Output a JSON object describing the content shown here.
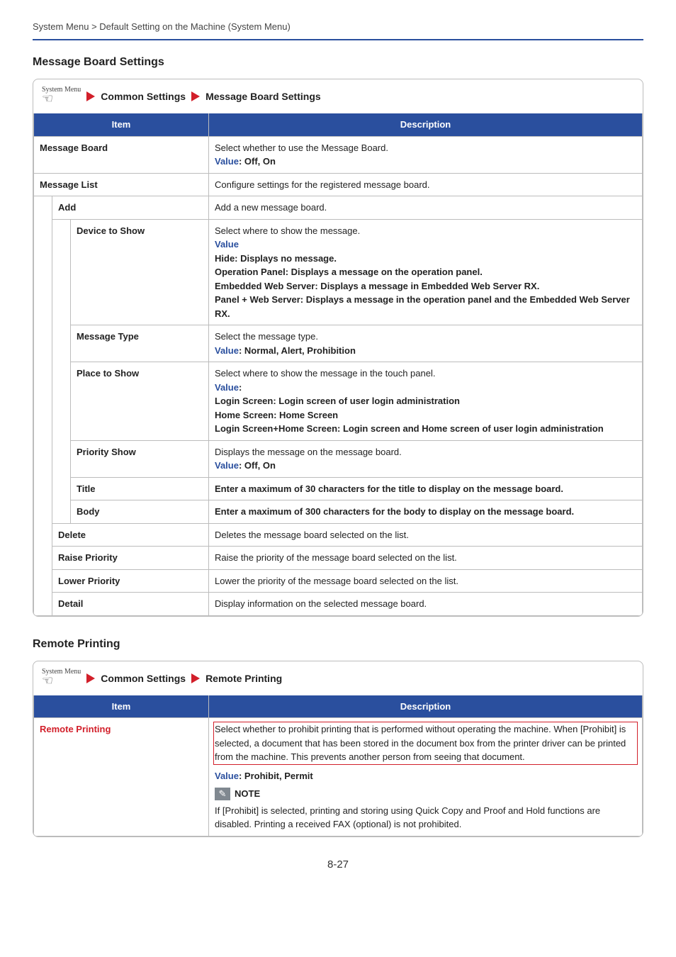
{
  "header": "System Menu > Default Setting on the Machine (System Menu)",
  "pageNumber": "8-27",
  "section1": {
    "title": "Message Board Settings",
    "breadcrumb": {
      "sys": "System Menu",
      "a": "Common Settings",
      "b": "Message Board Settings"
    },
    "th_item": "Item",
    "th_desc": "Description",
    "rows": {
      "msgboard": {
        "item": "Message Board",
        "d1": "Select whether to use the Message Board.",
        "d2a": "Value",
        "d2b": ": Off, On"
      },
      "msglist": {
        "item": "Message List",
        "d": "Configure settings for the registered message board."
      },
      "add": {
        "item": "Add",
        "d": "Add a new message board."
      },
      "device": {
        "item": "Device to Show",
        "d1": "Select where to show the message.",
        "d2": "Value",
        "d3": "Hide: Displays no message.",
        "d4": "Operation Panel: Displays a message on the operation panel.",
        "d5": "Embedded Web Server: Displays a message in Embedded Web Server RX.",
        "d6": "Panel + Web Server: Displays a message in the operation panel and the Embedded Web Server RX."
      },
      "mtype": {
        "item": "Message Type",
        "d1": "Select the message type.",
        "d2a": "Value",
        "d2b": ": Normal, Alert, Prohibition"
      },
      "place": {
        "item": "Place to Show",
        "d1": "Select where to show the message in the touch panel.",
        "d2a": "Value",
        "d2b": ":",
        "d3": "Login Screen: Login screen of user login administration",
        "d4": "Home Screen: Home Screen",
        "d5": "Login Screen+Home Screen: Login screen and Home screen of user login administration"
      },
      "prio": {
        "item": "Priority Show",
        "d1": "Displays the message on the message board.",
        "d2a": "Value",
        "d2b": ": Off, On"
      },
      "ttl": {
        "item": "Title",
        "d": "Enter a maximum of 30 characters for the title to display on the message board."
      },
      "body": {
        "item": "Body",
        "d": "Enter a maximum of 300 characters for the body to display on the message board."
      },
      "del": {
        "item": "Delete",
        "d": "Deletes the message board selected on the list."
      },
      "raise": {
        "item": "Raise Priority",
        "d": "Raise the priority of the message board selected on the list."
      },
      "lower": {
        "item": "Lower Priority",
        "d": "Lower the priority of the message board selected on the list."
      },
      "detail": {
        "item": "Detail",
        "d": "Display information on the selected message board."
      }
    }
  },
  "section2": {
    "title": "Remote Printing",
    "breadcrumb": {
      "sys": "System Menu",
      "a": "Common Settings",
      "b": "Remote Printing"
    },
    "th_item": "Item",
    "th_desc": "Description",
    "row": {
      "item": "Remote Printing",
      "d1": "Select whether to prohibit printing that is performed without operating the machine. When [Prohibit] is selected, a document that has been stored in the document box from the printer driver can be printed from the machine. This prevents another person from seeing that document.",
      "d2a": "Value",
      "d2b": ": Prohibit, Permit",
      "note": "NOTE",
      "d3": "If [Prohibit] is selected, printing and storing using Quick Copy and Proof and Hold functions are disabled. Printing a received FAX (optional) is not prohibited."
    }
  }
}
